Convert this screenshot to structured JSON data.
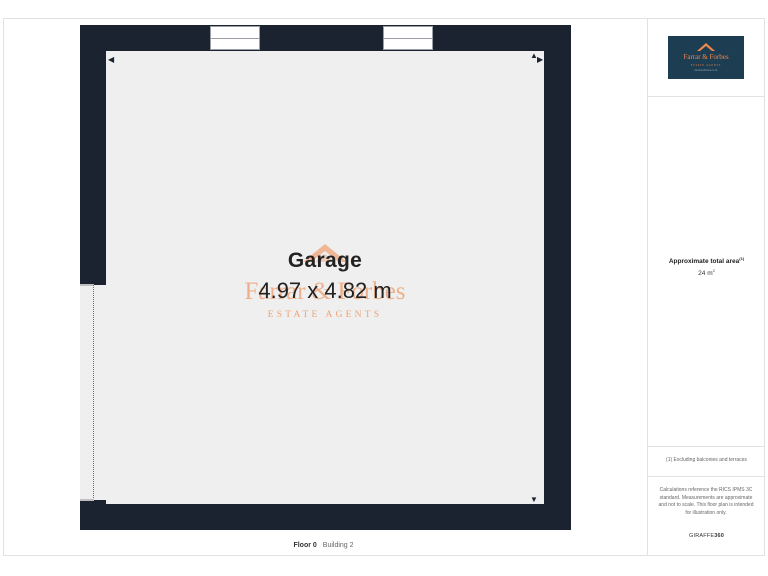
{
  "room": {
    "name": "Garage",
    "dimensions": "4.97 x 4.82 m"
  },
  "watermark": {
    "name": "Farrar & Forbes",
    "sub": "ESTATE AGENTS"
  },
  "floor_label": {
    "floor": "Floor 0",
    "building": "Building 2"
  },
  "logo": {
    "name": "Farrar & Forbes",
    "sub": "ESTATE AGENTS",
    "tag": "farrarandforbes.co.uk"
  },
  "area": {
    "title": "Approximate total area",
    "title_marker": "(1)",
    "value": "24 m",
    "unit_sup": "2"
  },
  "footnote": "(1) Excluding balconies and terraces",
  "calculations_note": "Calculations reference the RICS IPMS 3C standard. Measurements are approximate and not to scale. This floor plan is intended for illustration only.",
  "brand": {
    "prefix": "GIRAFFE",
    "suffix": "360"
  },
  "colors": {
    "wall": "#1b2330",
    "floor": "#efefef",
    "accent": "#ee894c",
    "logo_bg": "#1d3d52"
  }
}
